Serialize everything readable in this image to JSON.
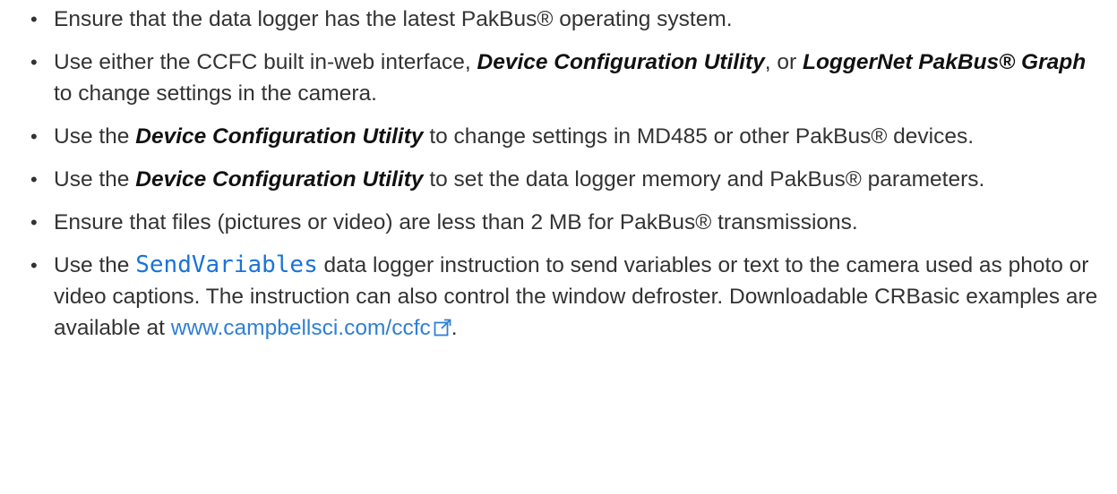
{
  "bullets": [
    {
      "parts": [
        {
          "t": "Ensure that the data logger has the latest PakBus® operating system."
        }
      ]
    },
    {
      "parts": [
        {
          "t": "Use either the CCFC built in-web interface, "
        },
        {
          "em": "Device Configuration Utility"
        },
        {
          "t": ", or "
        },
        {
          "em": "LoggerNet PakBus® Graph"
        },
        {
          "t": " to change settings in the camera."
        }
      ]
    },
    {
      "parts": [
        {
          "t": "Use the "
        },
        {
          "em": "Device Configuration Utility"
        },
        {
          "t": " to change settings in MD485 or other PakBus® devices."
        }
      ]
    },
    {
      "parts": [
        {
          "t": "Use the "
        },
        {
          "em": "Device Configuration Utility"
        },
        {
          "t": " to set the data logger memory and PakBus® parameters."
        }
      ]
    },
    {
      "parts": [
        {
          "t": "Ensure that files (pictures or video) are less than 2 MB for PakBus® transmissions."
        }
      ]
    },
    {
      "parts": [
        {
          "t": "Use the "
        },
        {
          "code": "SendVariables"
        },
        {
          "t": " data logger instruction to send variables or text to the camera used as photo or video captions. The instruction can also control the window defroster. Downloadable CRBasic examples are available at "
        },
        {
          "link": "www.campbellsci.com/ccfc",
          "icon": "external-link-icon"
        },
        {
          "t": "."
        }
      ]
    }
  ],
  "colors": {
    "text": "#333333",
    "code": "#1a73d9",
    "link": "#2f7fd6"
  },
  "bullet_char": "•"
}
